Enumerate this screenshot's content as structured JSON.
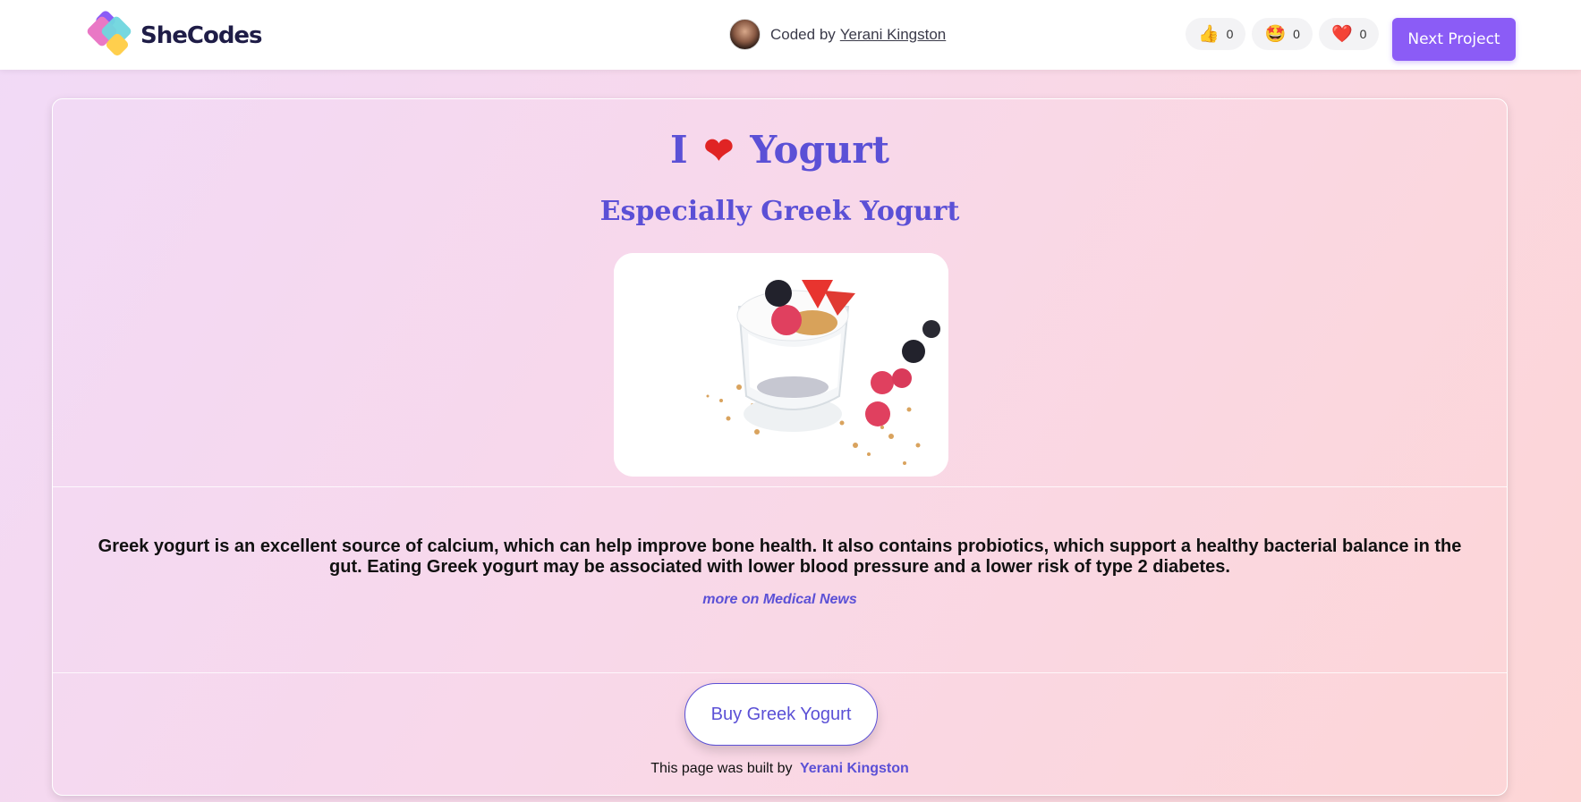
{
  "header": {
    "brand": "SheCodes",
    "coded_by_prefix": "Coded by",
    "author": "Yerani Kingston",
    "reactions": [
      {
        "icon": "thumbs-up-icon",
        "glyph": "👍",
        "count": "0"
      },
      {
        "icon": "star-struck-icon",
        "glyph": "🤩",
        "count": "0"
      },
      {
        "icon": "heart-icon",
        "glyph": "❤️",
        "count": "0"
      }
    ],
    "next_label": "Next Project"
  },
  "main": {
    "title_left": "I",
    "title_right": "Yogurt",
    "subtitle": "Especially Greek Yogurt",
    "description": "Greek yogurt is an excellent source of calcium, which can help improve bone health. It also contains probiotics, which support a healthy bacterial balance in the gut. Eating Greek yogurt may be associated with lower blood pressure and a lower risk of type 2 diabetes.",
    "more_link": "more on Medical News",
    "buy_label": "Buy Greek Yogurt",
    "footer_prefix": "This page was built by",
    "footer_author": "Yerani Kingston"
  },
  "colors": {
    "accent": "#5b50d6",
    "brand_purple": "#8b5cf6",
    "heart": "#e02424"
  }
}
